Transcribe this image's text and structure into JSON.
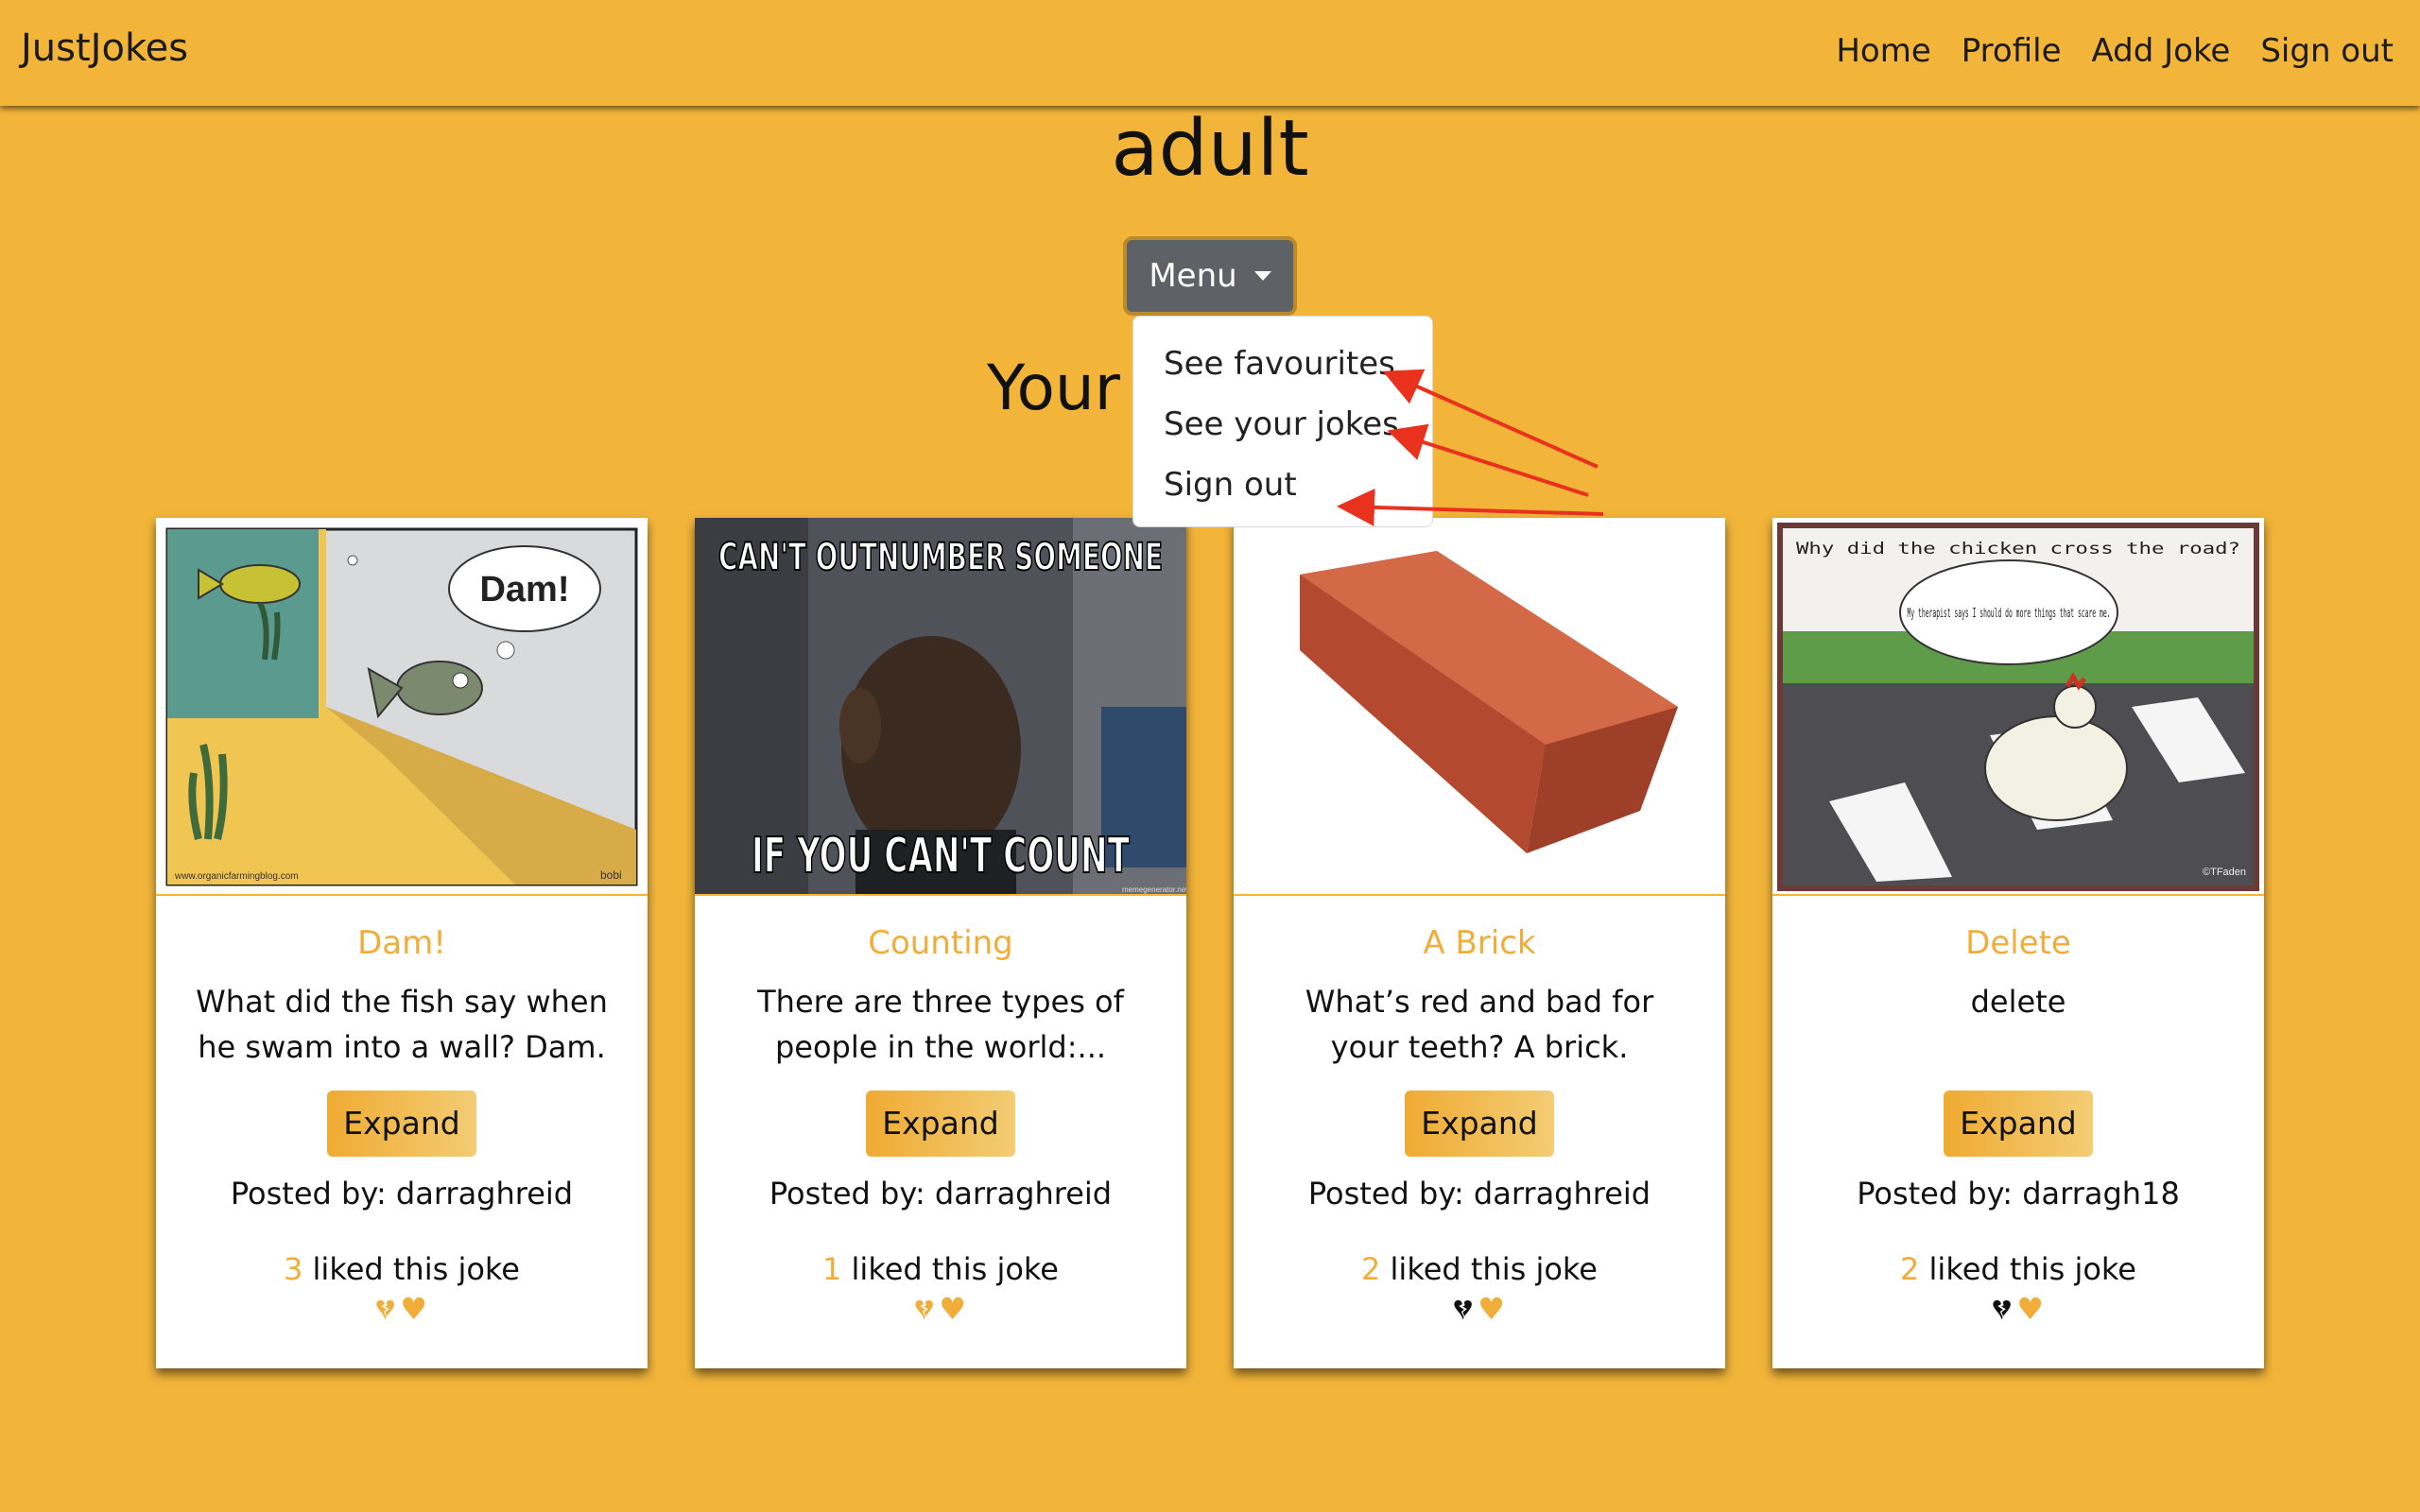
{
  "navbar": {
    "brand": "JustJokes",
    "links": [
      "Home",
      "Profile",
      "Add Joke",
      "Sign out"
    ]
  },
  "page_title": "adult",
  "menu": {
    "label": "Menu",
    "items": [
      "See favourites",
      "See your jokes",
      "Sign out"
    ]
  },
  "section_title": "Your",
  "cards": [
    {
      "title": "Dam!",
      "text": "What did the fish say when he swam into a wall? Dam.",
      "expand": "Expand",
      "posted_by": "Posted by: darraghreid",
      "likes_count": "3",
      "likes_suffix": " liked this joke",
      "unlike_active": true,
      "image_text": [
        "Dam!",
        "www.organicfarmingblog.com",
        "bobi"
      ]
    },
    {
      "title": "Counting",
      "text": "There are three types of people in the world:...",
      "expand": "Expand",
      "posted_by": "Posted by: darraghreid",
      "likes_count": "1",
      "likes_suffix": " liked this joke",
      "unlike_active": true,
      "image_text": [
        "CAN'T OUTNUMBER SOMEONE",
        "IF YOU CAN'T COUNT",
        "memegenerator.net"
      ]
    },
    {
      "title": "A Brick",
      "text": "What’s red and bad for your teeth? A brick.",
      "expand": "Expand",
      "posted_by": "Posted by: darraghreid",
      "likes_count": "2",
      "likes_suffix": " liked this joke",
      "unlike_active": false,
      "image_text": []
    },
    {
      "title": "Delete",
      "text": "delete",
      "expand": "Expand",
      "posted_by": "Posted by: darragh18",
      "likes_count": "2",
      "likes_suffix": " liked this joke",
      "unlike_active": false,
      "image_text": [
        "Why did the chicken cross the road?",
        "My therapist says I should do more things that scare me.",
        "©TFaden"
      ]
    }
  ],
  "colors": {
    "background": "#f2b53a",
    "accent": "#f0ad39",
    "menu_button": "#5e6166",
    "annotation_arrow": "#e8321e"
  },
  "icons": {
    "unlike": "broken-heart-icon",
    "like": "heart-icon"
  }
}
